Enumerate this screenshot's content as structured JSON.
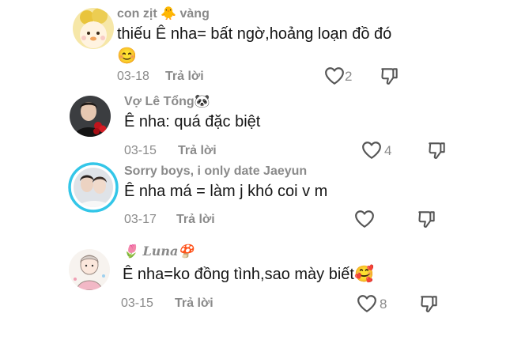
{
  "comments": [
    {
      "username": "con zịt",
      "username_emoji": "🐥",
      "username_suffix": " vàng",
      "text": "thiếu Ê nha= bất ngờ,hoảng loạn đồ đó",
      "text_line2": "😊",
      "date": "03-18",
      "reply_label": "Trả lời",
      "likes": "2"
    },
    {
      "username": "Vợ Lê Tổng",
      "username_emoji": "🐼",
      "text": "Ê nha: quá đặc biệt",
      "date": "03-15",
      "reply_label": "Trả lời",
      "likes": "4"
    },
    {
      "username": "Sorry boys, i only date Jaeyun",
      "text": "Ê nha má = làm j khó coi v m",
      "date": "03-17",
      "reply_label": "Trả lời",
      "likes": ""
    },
    {
      "username_emoji_pre": "🌷",
      "username": "Luna",
      "username_emoji": "🍄",
      "text": "Ê nha=ko đồng tình,sao mày biết",
      "text_emoji": "🥰",
      "date": "03-15",
      "reply_label": "Trả lời",
      "likes": "8"
    }
  ],
  "colors": {
    "text": "#161616",
    "muted": "#8a8a8a",
    "icon": "#555555",
    "story_ring": "#33c6e8"
  }
}
